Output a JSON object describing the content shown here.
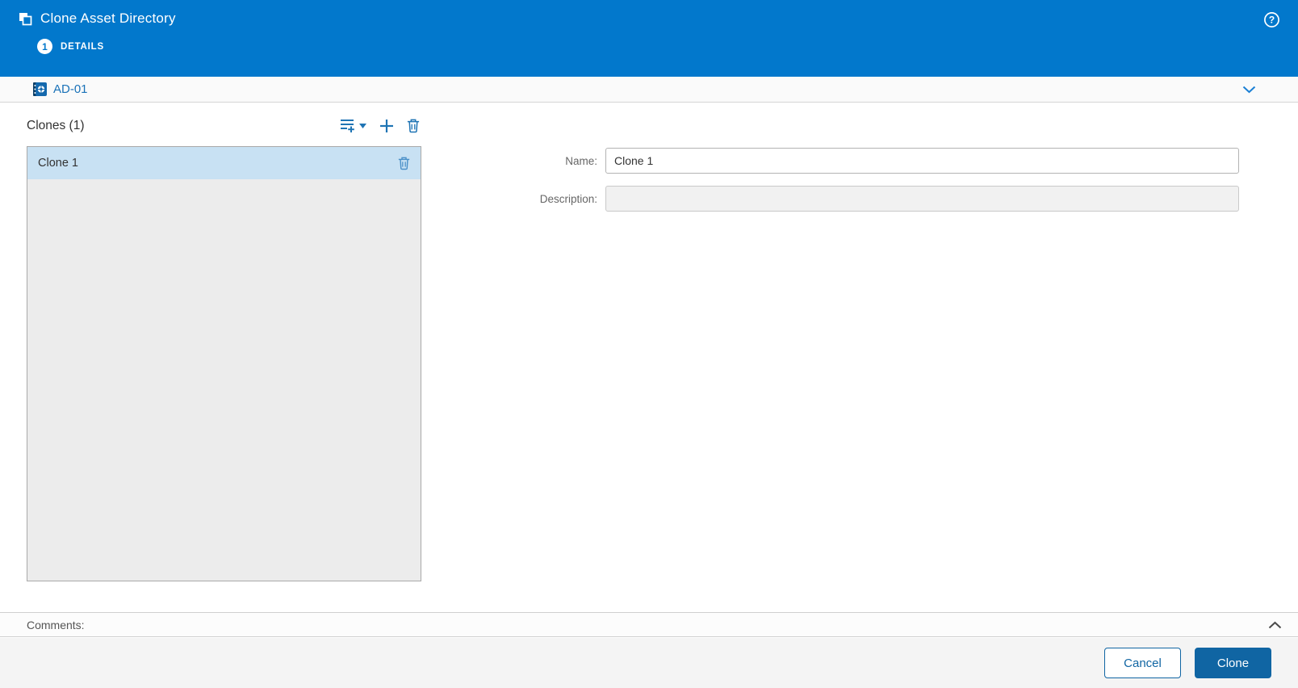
{
  "header": {
    "title": "Clone Asset Directory",
    "step": {
      "number": "1",
      "label": "DETAILS"
    }
  },
  "asset": {
    "name": "AD-01"
  },
  "clones": {
    "heading": "Clones (1)",
    "items": [
      {
        "label": "Clone 1",
        "selected": true
      }
    ]
  },
  "form": {
    "name_label": "Name:",
    "name_value": "Clone 1",
    "description_label": "Description:",
    "description_value": ""
  },
  "comments": {
    "label": "Comments:"
  },
  "footer": {
    "cancel_label": "Cancel",
    "clone_label": "Clone"
  },
  "icons": {
    "title": "clone-icon",
    "help": "help-icon",
    "asset": "asset-directory-icon",
    "toolbar": [
      "add-multiple-icon",
      "caret-down-icon",
      "plus-icon",
      "trash-icon"
    ],
    "item": "trash-icon",
    "asset_row": "chevron-down-icon",
    "comments_row": "chevron-up-icon"
  },
  "colors": {
    "header_blue": "#0278cc",
    "accent_blue": "#1f74b4",
    "selected_row": "#c8e1f3",
    "button_blue": "#1065a3",
    "panel_gray": "#ececec"
  }
}
